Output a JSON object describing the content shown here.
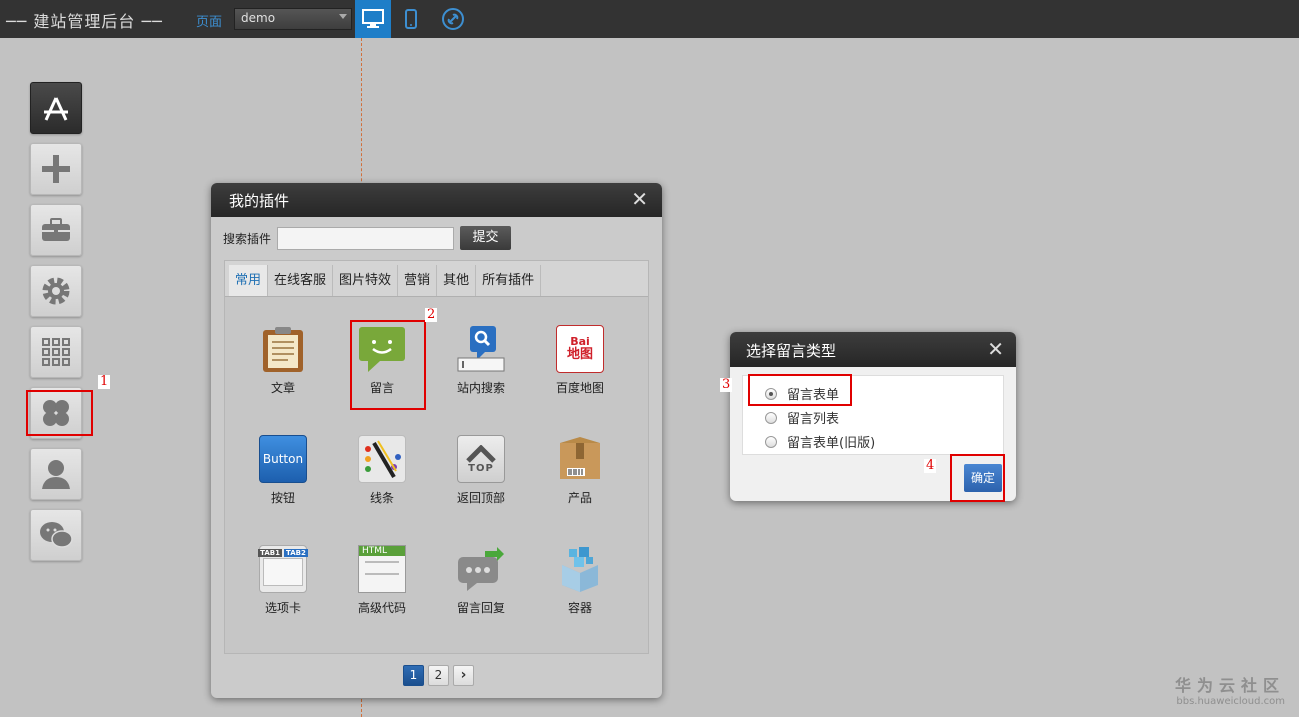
{
  "topbar": {
    "brand": "建站管理后台",
    "page_label": "页面",
    "page_select_value": "demo",
    "device_buttons": [
      {
        "icon": "desktop-icon",
        "active": true
      },
      {
        "icon": "mobile-icon",
        "active": false
      },
      {
        "icon": "link-icon",
        "active": false
      }
    ]
  },
  "sidebar": {
    "items": [
      {
        "icon": "app-store-icon"
      },
      {
        "icon": "plus-icon"
      },
      {
        "icon": "toolbox-icon"
      },
      {
        "icon": "gear-icon"
      },
      {
        "icon": "grid-icon"
      },
      {
        "icon": "plugin-icon"
      },
      {
        "icon": "user-icon"
      },
      {
        "icon": "wechat-icon"
      }
    ]
  },
  "annotations": {
    "n1": "1",
    "n2": "2",
    "n3": "3",
    "n4": "4"
  },
  "plugin_panel": {
    "title": "我的插件",
    "close": "✕",
    "search_label": "搜索插件",
    "search_value": "",
    "submit_label": "提交",
    "tabs": [
      "常用",
      "在线客服",
      "图片特效",
      "营销",
      "其他",
      "所有插件"
    ],
    "items": [
      {
        "label": "文章",
        "icon": "article-icon"
      },
      {
        "label": "留言",
        "icon": "message-icon"
      },
      {
        "label": "站内搜索",
        "icon": "site-search-icon"
      },
      {
        "label": "百度地图",
        "icon": "baidu-map-icon",
        "icon_text_top": "Bai",
        "icon_text_bottom": "地图"
      },
      {
        "label": "按钮",
        "icon": "button-icon",
        "icon_text": "Button"
      },
      {
        "label": "线条",
        "icon": "line-icon"
      },
      {
        "label": "返回顶部",
        "icon": "back-to-top-icon",
        "icon_text": "TOP"
      },
      {
        "label": "产品",
        "icon": "product-icon"
      },
      {
        "label": "选项卡",
        "icon": "tab-card-icon",
        "icon_text_a": "TAB1",
        "icon_text_b": "TAB2"
      },
      {
        "label": "高级代码",
        "icon": "html-code-icon",
        "icon_text": "HTML"
      },
      {
        "label": "留言回复",
        "icon": "message-reply-icon"
      },
      {
        "label": "容器",
        "icon": "container-icon"
      }
    ],
    "pager": {
      "pages": [
        "1",
        "2"
      ],
      "next": "›",
      "current": "1"
    }
  },
  "dialog": {
    "title": "选择留言类型",
    "close": "✕",
    "options": [
      {
        "label": "留言表单",
        "checked": true
      },
      {
        "label": "留言列表",
        "checked": false
      },
      {
        "label": "留言表单(旧版)",
        "checked": false
      }
    ],
    "ok_label": "确定"
  },
  "watermark": {
    "line1": "华为云社区",
    "line2": "bbs.huaweicloud.com"
  },
  "colors": {
    "accent": "#1e7ec8",
    "highlight": "#e00000",
    "topbar": "#333333"
  }
}
